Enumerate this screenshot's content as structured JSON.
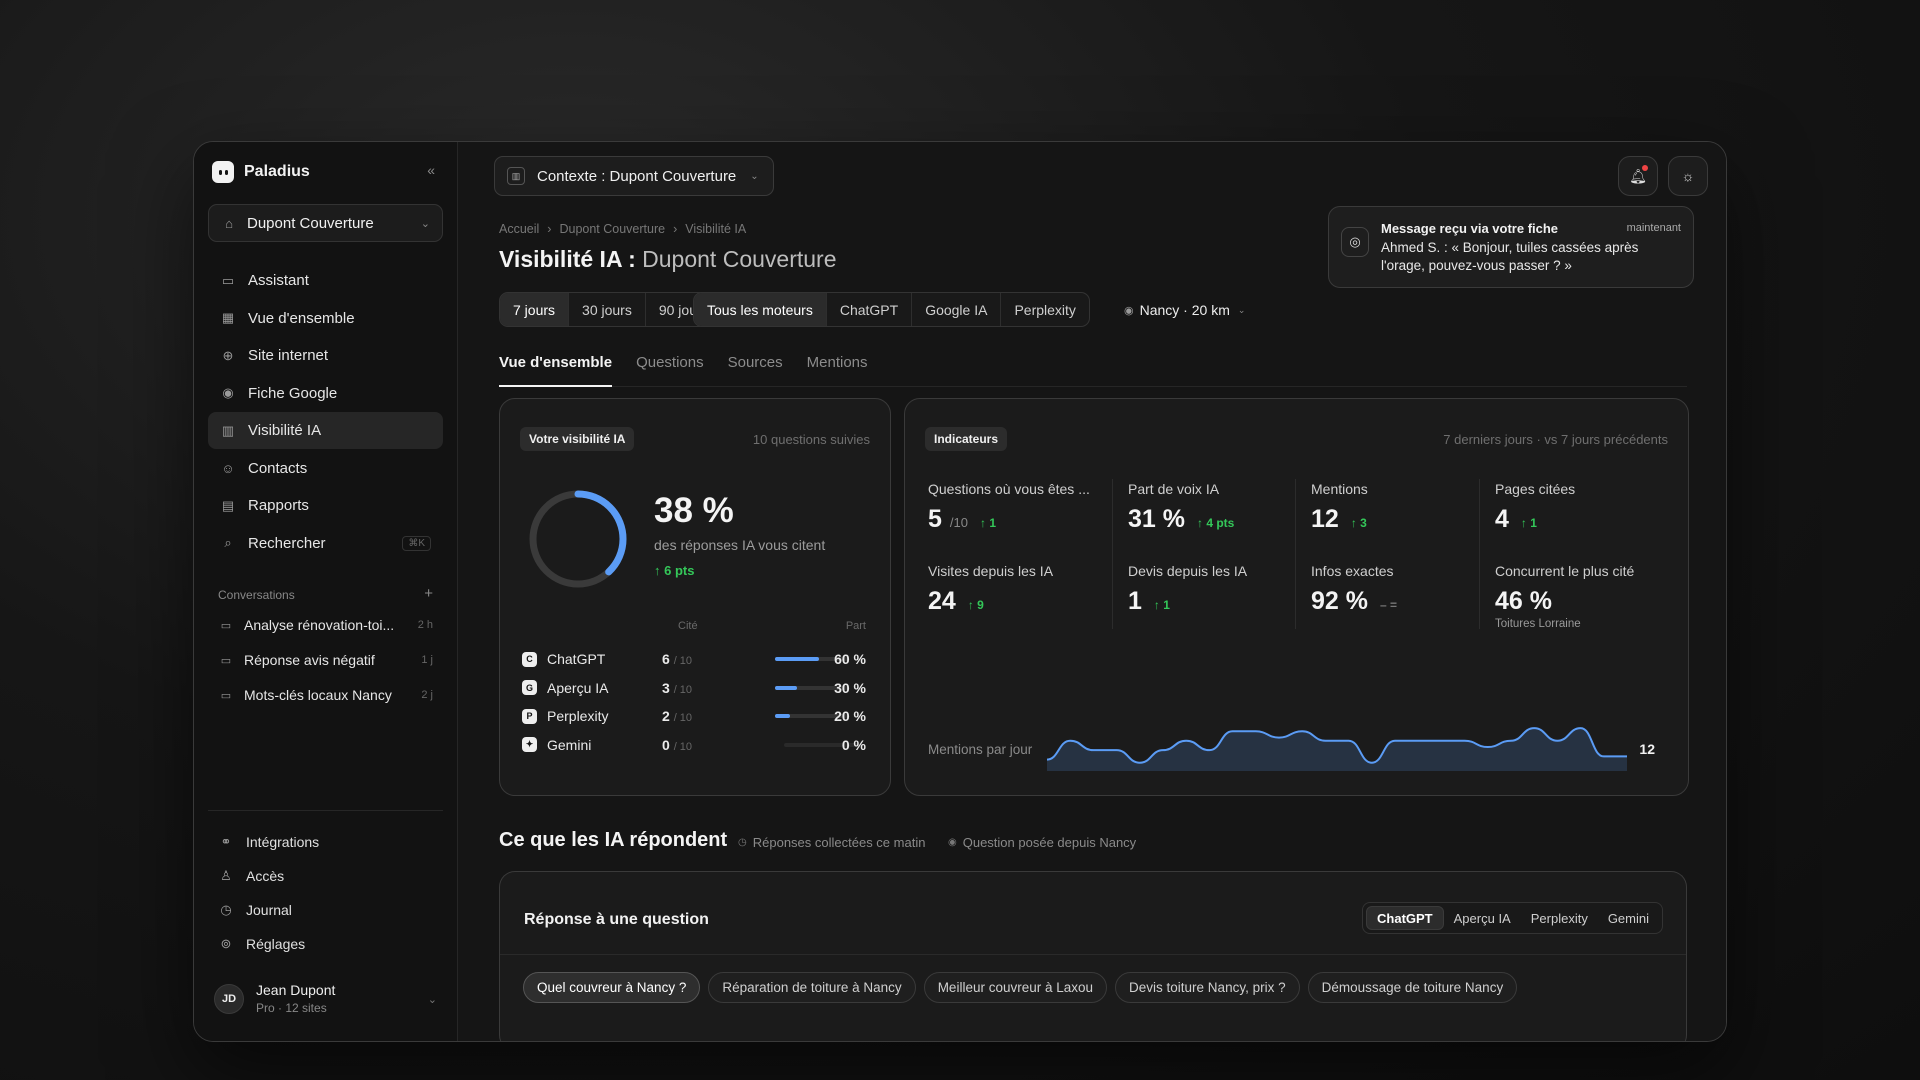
{
  "sidebar": {
    "brand": "Paladius",
    "workspace": "Dupont Couverture",
    "nav": [
      {
        "label": "Assistant",
        "icon": "chat-icon"
      },
      {
        "label": "Vue d'ensemble",
        "icon": "grid-icon"
      },
      {
        "label": "Site internet",
        "icon": "globe-icon"
      },
      {
        "label": "Fiche Google",
        "icon": "pin-icon"
      },
      {
        "label": "Visibilité IA",
        "icon": "bar-chart-icon",
        "active": true
      },
      {
        "label": "Contacts",
        "icon": "users-icon"
      },
      {
        "label": "Rapports",
        "icon": "report-icon"
      },
      {
        "label": "Rechercher",
        "icon": "search-icon",
        "shortcut": "⌘K"
      }
    ],
    "conversations_label": "Conversations",
    "conversations": [
      {
        "title": "Analyse rénovation-toi...",
        "time": "2 h"
      },
      {
        "title": "Réponse avis négatif",
        "time": "1 j"
      },
      {
        "title": "Mots-clés locaux Nancy",
        "time": "2 j"
      }
    ],
    "bottom_nav": [
      {
        "label": "Intégrations",
        "icon": "link-icon"
      },
      {
        "label": "Accès",
        "icon": "user-icon"
      },
      {
        "label": "Journal",
        "icon": "clock-icon"
      },
      {
        "label": "Réglages",
        "icon": "settings-icon"
      }
    ],
    "user": {
      "initials": "JD",
      "name": "Jean Dupont",
      "plan": "Pro · 12 sites"
    }
  },
  "header": {
    "context": "Contexte : Dupont Couverture",
    "toast": {
      "title": "Message reçu via votre fiche",
      "time": "maintenant",
      "message": "Ahmed S. : « Bonjour, tuiles cassées après l'orage, pouvez-vous passer ? »"
    }
  },
  "breadcrumb": [
    "Accueil",
    "Dupont Couverture",
    "Visibilité IA"
  ],
  "title": {
    "main": "Visibilité IA :",
    "sub": "Dupont Couverture"
  },
  "filters": {
    "periods": [
      "7 jours",
      "30 jours",
      "90 jours"
    ],
    "active_period": 0,
    "engines": [
      "Tous les moteurs",
      "ChatGPT",
      "Google IA",
      "Perplexity"
    ],
    "active_engine": 0,
    "location": "Nancy · 20 km"
  },
  "tabs": [
    "Vue d'ensemble",
    "Questions",
    "Sources",
    "Mentions"
  ],
  "visibility_card": {
    "badge": "Votre visibilité IA",
    "tracked": "10 questions suivies",
    "percent_label": "38 %",
    "percent_value": 38,
    "description": "des réponses IA vous citent",
    "delta": "↑ 6 pts",
    "col_cited": "Cité",
    "col_share": "Part",
    "engines": [
      {
        "letter": "C",
        "name": "ChatGPT",
        "cited": "6",
        "of": "/ 10",
        "share": 60,
        "share_label": "60 %"
      },
      {
        "letter": "G",
        "name": "Aperçu IA",
        "cited": "3",
        "of": "/ 10",
        "share": 30,
        "share_label": "30 %"
      },
      {
        "letter": "P",
        "name": "Perplexity",
        "cited": "2",
        "of": "/ 10",
        "share": 20,
        "share_label": "20 %"
      },
      {
        "letter": "✦",
        "name": "Gemini",
        "cited": "0",
        "of": "/ 10",
        "share": 0,
        "share_label": "0 %"
      }
    ]
  },
  "indicators": {
    "badge": "Indicateurs",
    "period": "7 derniers jours · vs 7 jours précédents",
    "metrics": [
      {
        "label": "Questions où vous êtes ...",
        "value": "5",
        "suffix": "/10",
        "delta": "↑ 1"
      },
      {
        "label": "Part de voix IA",
        "value": "31 %",
        "suffix": "",
        "delta": "↑ 4 pts"
      },
      {
        "label": "Mentions",
        "value": "12",
        "suffix": "",
        "delta": "↑ 3"
      },
      {
        "label": "Pages citées",
        "value": "4",
        "suffix": "",
        "delta": "↑ 1"
      },
      {
        "label": "Visites depuis les IA",
        "value": "24",
        "suffix": "",
        "delta": "↑ 9"
      },
      {
        "label": "Devis depuis les IA",
        "value": "1",
        "suffix": "",
        "delta": "↑ 1"
      },
      {
        "label": "Infos exactes",
        "value": "92 %",
        "suffix": "",
        "delta": "– ="
      },
      {
        "label": "Concurrent le plus cité",
        "value": "46 %",
        "suffix": "",
        "delta": "",
        "note": "Toitures Lorraine"
      }
    ],
    "sparkline_label": "Mentions par jour",
    "sparkline_last": "12"
  },
  "chart_data": {
    "type": "area",
    "title": "Mentions par jour",
    "values": [
      3,
      9,
      6,
      6,
      2,
      6,
      9,
      6,
      12,
      12,
      10,
      12,
      9,
      9,
      2,
      9,
      9,
      9,
      9,
      7,
      9,
      13,
      9,
      13,
      4,
      4
    ]
  },
  "answers": {
    "title": "Ce que les IA répondent",
    "meta1": "Réponses collectées ce matin",
    "meta2": "Question posée depuis Nancy",
    "card_title": "Réponse à une question",
    "engines": [
      "ChatGPT",
      "Aperçu IA",
      "Perplexity",
      "Gemini"
    ],
    "questions": [
      "Quel couvreur à Nancy ?",
      "Réparation de toiture à Nancy",
      "Meilleur couvreur à Laxou",
      "Devis toiture Nancy, prix ?",
      "Démoussage de toiture Nancy"
    ]
  },
  "colors": {
    "accent": "#5b9cf5",
    "positive": "#34c759",
    "alert": "#ef4444"
  }
}
